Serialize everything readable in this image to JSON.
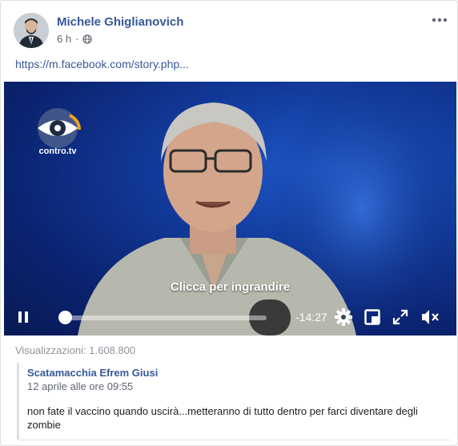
{
  "post": {
    "author": "Michele Ghiglianovich",
    "time": "6 h",
    "privacy_icon": "globe-icon",
    "more_icon": "more-options-icon",
    "link": "https://m.facebook.com/story.php..."
  },
  "video": {
    "logo_text": "contro.tv",
    "overlay_text": "Clicca per ingrandire",
    "progress_fraction": 0.0,
    "time_remaining": "-14:27",
    "icons": [
      "pause-icon",
      "settings-icon",
      "picture-in-picture-icon",
      "fullscreen-icon",
      "mute-icon"
    ]
  },
  "views": "Visualizzazioni: 1.608.800",
  "comment": {
    "author": "Scatamacchia Efrem Giusi",
    "date": "12 aprile alle ore 09:55",
    "text": "non fate il vaccino quando uscirà...metteranno di tutto dentro per farci diventare degli zombie"
  },
  "colors": {
    "link": "#385898",
    "secondary_text": "#606770",
    "video_bg": "#123b9c"
  }
}
